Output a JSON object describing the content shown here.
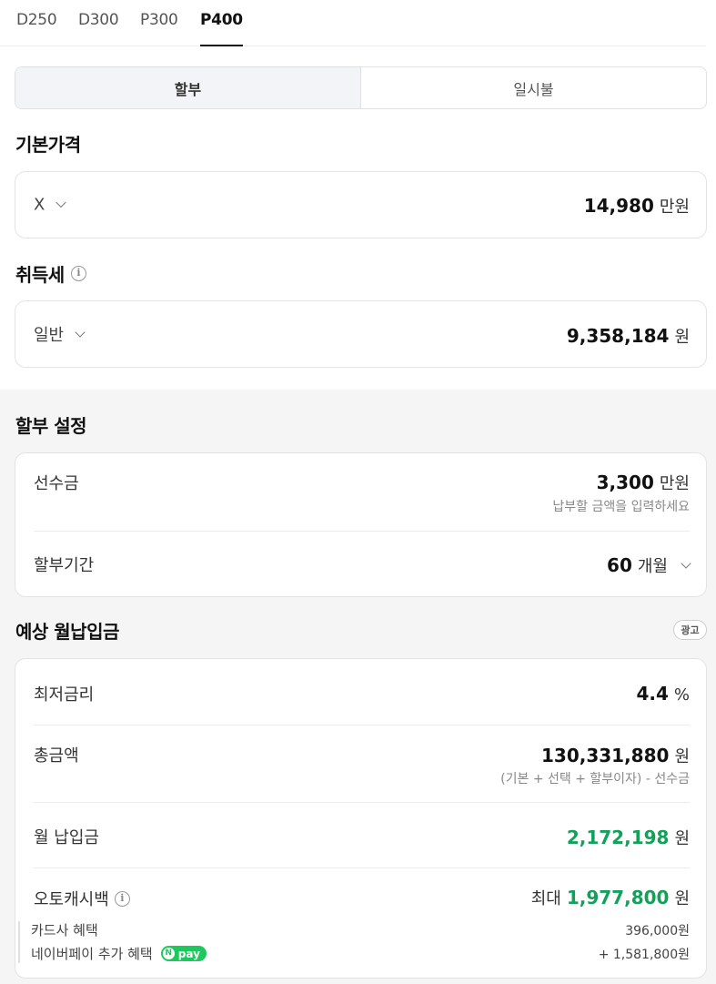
{
  "tabs": [
    {
      "label": "D250",
      "active": false
    },
    {
      "label": "D300",
      "active": false
    },
    {
      "label": "P300",
      "active": false
    },
    {
      "label": "P400",
      "active": true
    }
  ],
  "payment_mode": {
    "installment": "할부",
    "lump_sum": "일시불",
    "selected": "installment"
  },
  "base_price": {
    "title": "기본가격",
    "trim": "X",
    "value": "14,980",
    "unit": "만원"
  },
  "acquisition_tax": {
    "title": "취득세",
    "info_icon": "info-icon",
    "type": "일반",
    "value": "9,358,184",
    "unit": "원"
  },
  "installment_settings": {
    "title": "할부 설정",
    "down_payment": {
      "label": "선수금",
      "value": "3,300",
      "unit": "만원",
      "hint": "납부할 금액을 입력하세요"
    },
    "period": {
      "label": "할부기간",
      "value": "60",
      "unit": "개월"
    }
  },
  "estimate": {
    "title": "예상 월납입금",
    "ad_badge": "광고",
    "min_rate": {
      "label": "최저금리",
      "value": "4.4",
      "unit": "%"
    },
    "total": {
      "label": "총금액",
      "value": "130,331,880",
      "unit": "원",
      "note": "(기본 + 선택 + 할부이자) - 선수금"
    },
    "monthly": {
      "label": "월 납입금",
      "value": "2,172,198",
      "unit": "원"
    },
    "autocash": {
      "label": "오토캐시백",
      "prefix": "최대",
      "value": "1,977,800",
      "unit": "원",
      "card_label": "카드사 혜택",
      "card_value": "396,000원",
      "npay_label": "네이버페이 추가 혜택",
      "npay_badge": "pay",
      "npay_value": "+ 1,581,800원"
    }
  },
  "colors": {
    "accent_green": "#13a05a",
    "npay_green": "#1fc85e"
  }
}
